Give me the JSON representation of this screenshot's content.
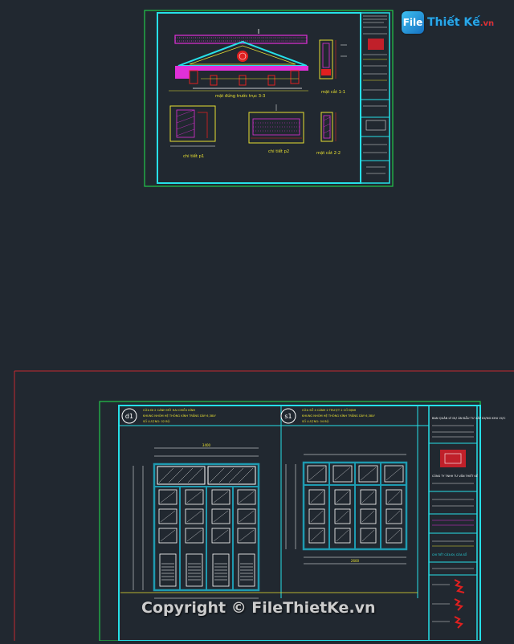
{
  "watermark": {
    "text": "Copyright © FileThietKe.vn",
    "brand_badge": "File",
    "brand_name": "Thiết Kế",
    "brand_tail": ".vn"
  },
  "sheet1": {
    "title_elevation": "mặt đứng trước trục 3-3",
    "title_section_1": "mặt cắt 1-1",
    "title_section_2": "mặt cắt 2-2",
    "title_detail_1": "chi tiết p1",
    "title_detail_2": "chi tiết p2",
    "marker_1": "1"
  },
  "sheet2": {
    "door_label": "d1",
    "door_title_line1": "CỬA ĐI 2 CÁNH MỞ HAI CHIỀU KÍNH",
    "door_title_line2": "KHUNG NHÔM HỆ THÔNG KÍNH TRẮNG DÀY 6,38LY",
    "door_title_line3": "SỐ LƯỢNG: 02 BỘ",
    "window_label": "s1",
    "window_title_line1": "CỬA SỔ 4 CÁNH 2 TRƯỢT 2 CỐ ĐỊNH",
    "window_title_line2": "KHUNG NHÔM HỆ THÔNG KÍNH TRẮNG DÀY 6,38LY",
    "window_title_line3": "SỐ LƯỢNG: 04 BỘ",
    "dim_door_width": "3400",
    "dim_window_width": "2600",
    "company": "CÔNG TY TNHH TƯ VẤN THIẾT KẾ",
    "client": "BAN QUẢN LÝ DỰ ÁN ĐẦU TƯ XÂY DỰNG KHU VỰC",
    "drawing_name": "CHI TIẾT CỬA ĐI, CỬA SỔ"
  },
  "colors": {
    "background": "#212830",
    "frame_green": "#22c84a",
    "frame_cyan": "#26e0e8",
    "frame_red": "#c22a30",
    "magenta": "#e030d8",
    "yellow": "#e8e032",
    "red": "#e02020"
  }
}
